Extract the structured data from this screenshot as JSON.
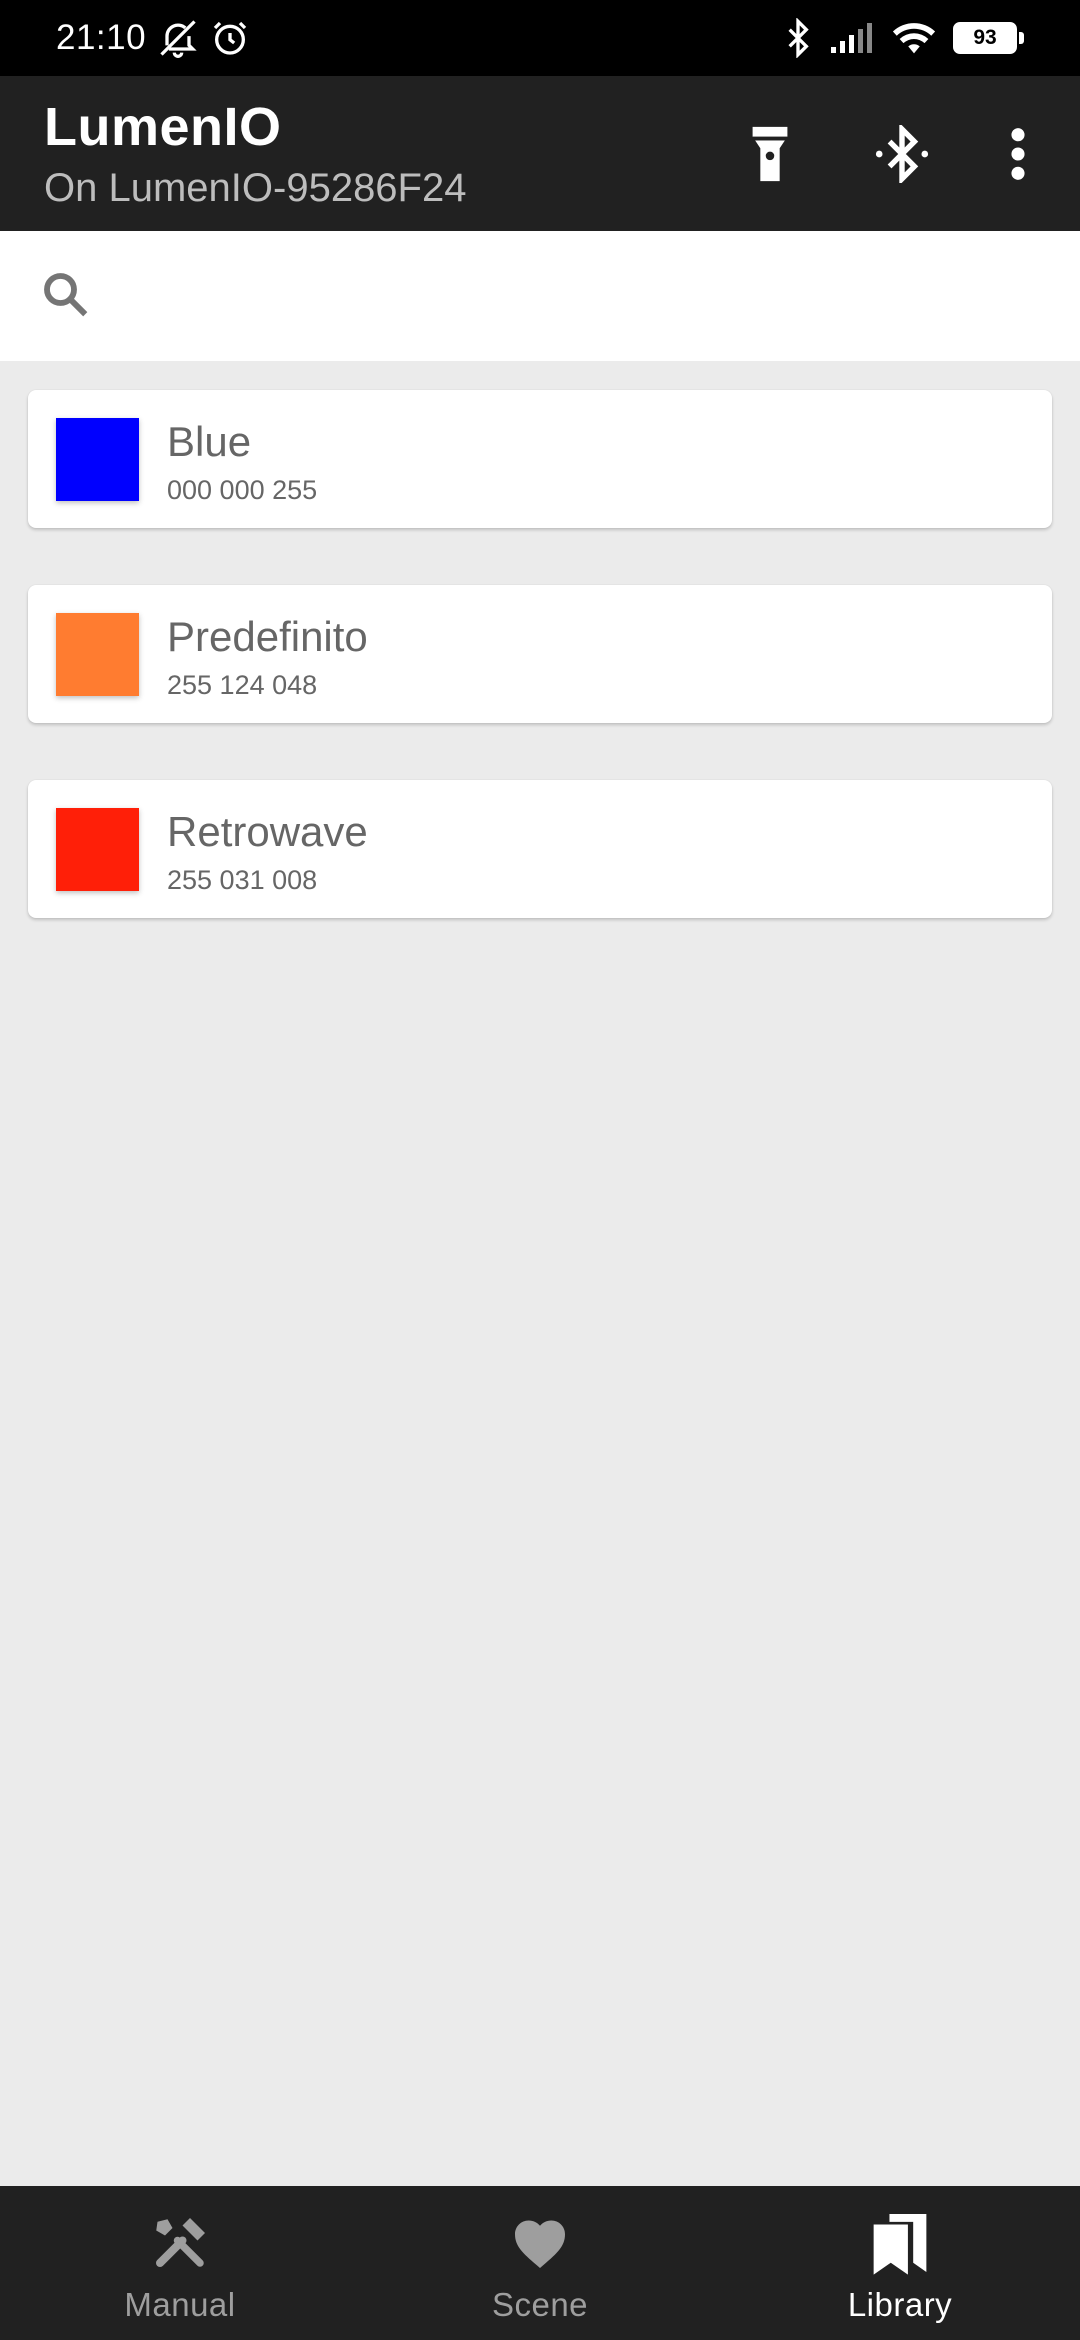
{
  "status_bar": {
    "time": "21:10",
    "battery": "93"
  },
  "app_bar": {
    "title": "LumenIO",
    "subtitle": "On LumenIO-95286F24"
  },
  "search": {
    "placeholder": ""
  },
  "library": [
    {
      "name": "Blue",
      "rgb": "000 000 255",
      "color": "#0000ff"
    },
    {
      "name": "Predefinito",
      "rgb": "255 124 048",
      "color": "#ff7c30"
    },
    {
      "name": "Retrowave",
      "rgb": "255 031 008",
      "color": "#ff1f08"
    }
  ],
  "bottom_nav": [
    {
      "label": "Manual",
      "icon": "tools-icon",
      "active": false
    },
    {
      "label": "Scene",
      "icon": "heart-icon",
      "active": false
    },
    {
      "label": "Library",
      "icon": "library-icon",
      "active": true
    }
  ],
  "colors": {
    "app_bar": "#212121",
    "background": "#ebebeb",
    "nav_inactive": "#9e9e9e",
    "nav_active": "#ffffff"
  }
}
